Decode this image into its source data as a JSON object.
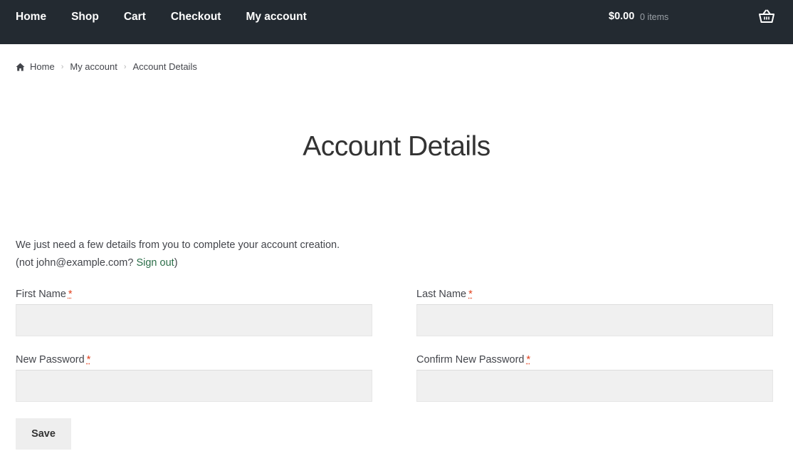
{
  "nav": {
    "items": [
      "Home",
      "Shop",
      "Cart",
      "Checkout",
      "My account"
    ]
  },
  "cart": {
    "total": "$0.00",
    "count": "0 items",
    "icon": "basket-icon"
  },
  "breadcrumb": {
    "icon": "home-icon",
    "items": [
      "Home",
      "My account",
      "Account Details"
    ],
    "separator": "›"
  },
  "page": {
    "title": "Account Details",
    "intro_line1": "We just need a few details from you to complete your account creation.",
    "intro_prefix": "(not john@example.com? ",
    "signout_label": "Sign out",
    "intro_suffix": ")"
  },
  "form": {
    "required_mark": "*",
    "first_name_label": "First Name",
    "first_name_value": "",
    "last_name_label": "Last Name",
    "last_name_value": "",
    "new_password_label": "New Password",
    "new_password_value": "",
    "confirm_password_label": "Confirm New Password",
    "confirm_password_value": "",
    "save_label": "Save"
  },
  "colors": {
    "header_bg": "#232a31",
    "link_accent": "#2c6e49",
    "required": "#e2401c",
    "input_bg": "#f0f0f0"
  }
}
